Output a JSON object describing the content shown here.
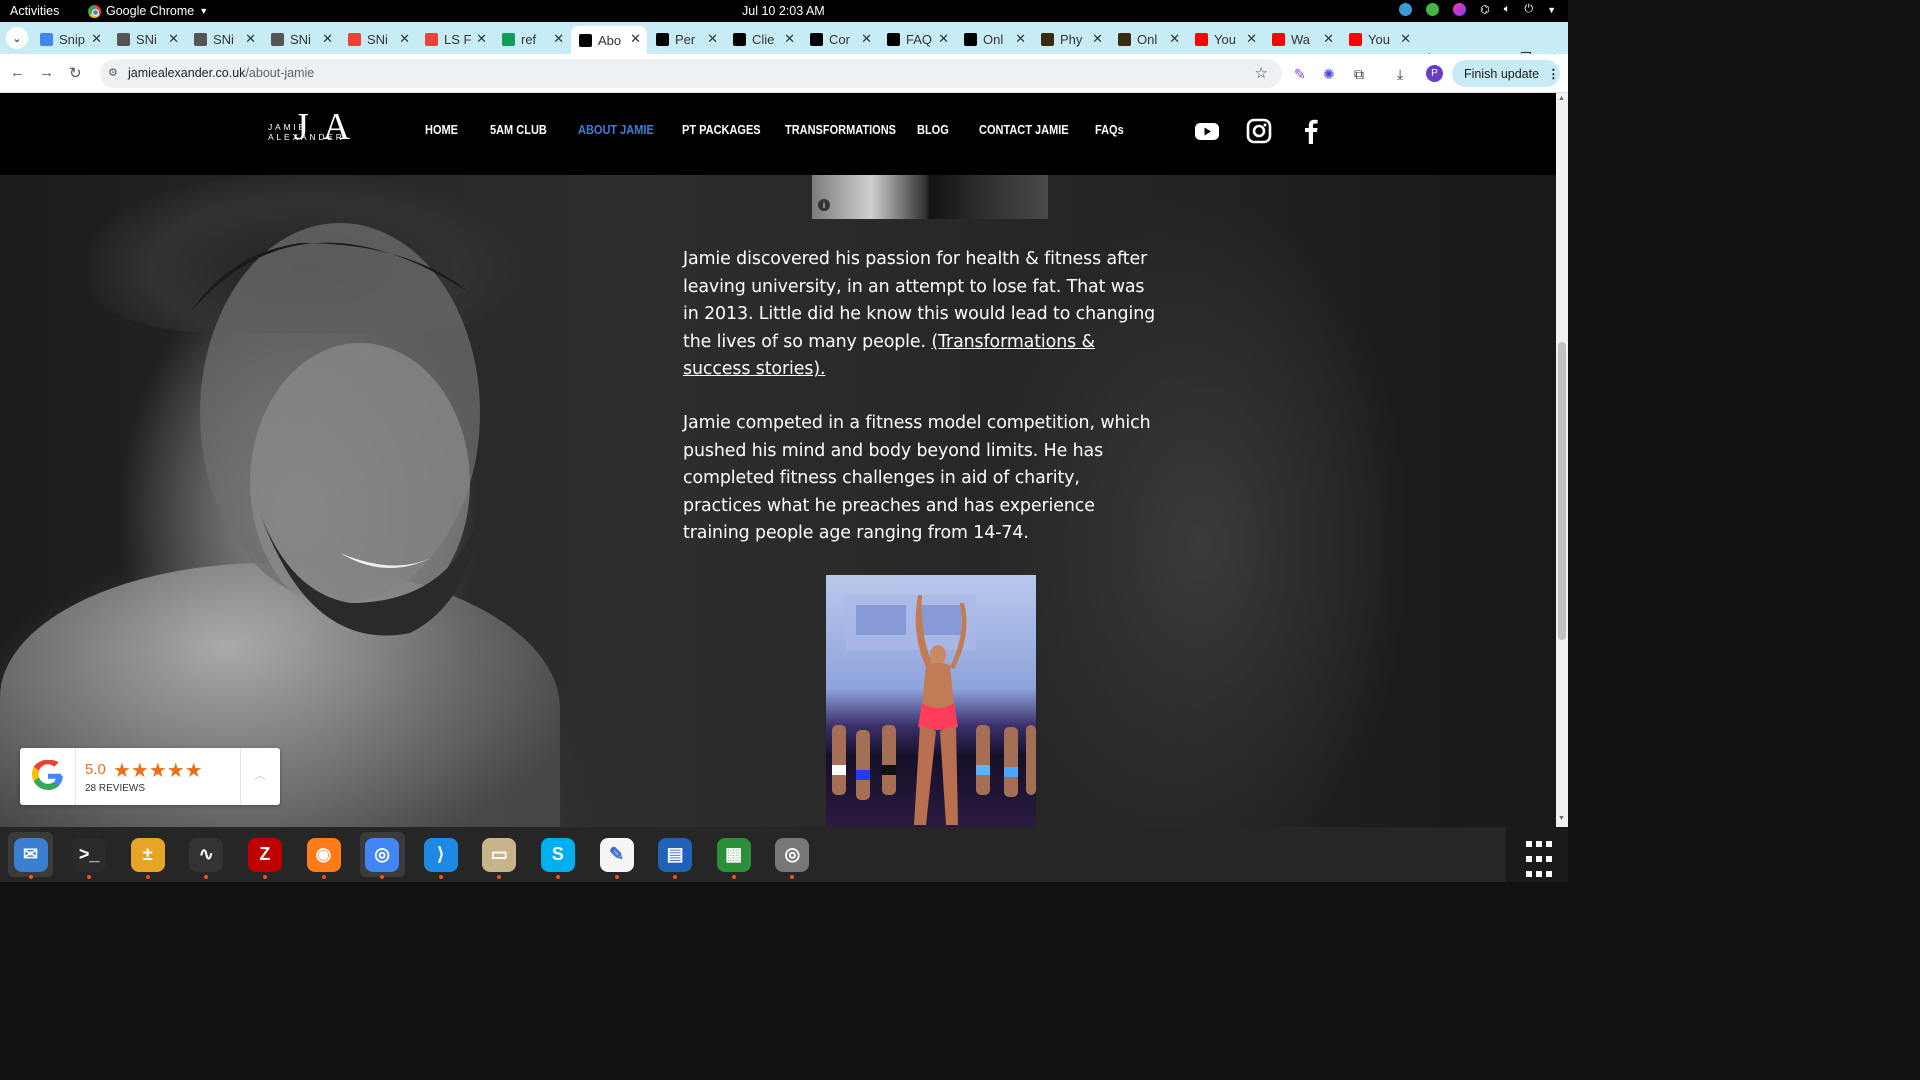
{
  "system": {
    "activities": "Activities",
    "app_name": "Google Chrome",
    "clock": "Jul 10  2:03 AM"
  },
  "tabs": [
    {
      "title": "Snip",
      "color": "#4285f4"
    },
    {
      "title": "SNi",
      "color": "#555555"
    },
    {
      "title": "SNi",
      "color": "#555555"
    },
    {
      "title": "SNi",
      "color": "#555555"
    },
    {
      "title": "SNi",
      "color": "#ea4335"
    },
    {
      "title": "LS F",
      "color": "#ea4335"
    },
    {
      "title": "ref",
      "color": "#0f9d58"
    },
    {
      "title": "Abo",
      "color": "#000000"
    },
    {
      "title": "Per",
      "color": "#000000"
    },
    {
      "title": "Clie",
      "color": "#000000"
    },
    {
      "title": "Cor",
      "color": "#000000"
    },
    {
      "title": "FAQ",
      "color": "#000000"
    },
    {
      "title": "Onl",
      "color": "#000000"
    },
    {
      "title": "Phy",
      "color": "#3a2a10"
    },
    {
      "title": "Onl",
      "color": "#3a2a10"
    },
    {
      "title": "You",
      "color": "#ff0000"
    },
    {
      "title": "Wa",
      "color": "#ff0000"
    },
    {
      "title": "You",
      "color": "#ff0000"
    }
  ],
  "address_bar": {
    "domain": "jamiealexander.co.uk",
    "path": "/about-jamie",
    "finish_update": "Finish update",
    "profile_initial": "P"
  },
  "site": {
    "logo_mark": "JA",
    "logo_name": "JAMIE ALEXANDER",
    "nav": [
      "HOME",
      "5AM CLUB",
      "ABOUT JAMIE",
      "PT PACKAGES",
      "TRANSFORMATIONS",
      "BLOG",
      "CONTACT JAMIE",
      "FAQs"
    ],
    "current_nav": "ABOUT JAMIE",
    "social": [
      "youtube-icon",
      "instagram-icon",
      "facebook-icon"
    ],
    "paragraph1": "Jamie discovered his passion for health & fitness after leaving university, in an attempt to lose fat. That was in 2013. Little did he know this would lead to changing the lives of so many people. ",
    "paragraph1_link": "(Transformations & success stories).",
    "paragraph2": "Jamie competed in a fitness model competition, which pushed his mind and body beyond limits. He has completed fitness challenges in aid of charity, practices what he preaches and has experience training people age ranging from 14-74."
  },
  "reviews": {
    "score": "5.0",
    "stars": "★★★★★",
    "count": "28 REVIEWS"
  },
  "dock": [
    "thunderbird-icon",
    "terminal-icon",
    "calculator-icon",
    "system-monitor-icon",
    "filezilla-icon",
    "firefox-icon",
    "chrome-icon",
    "vscode-icon",
    "files-icon",
    "skype-icon",
    "text-editor-icon",
    "libreoffice-writer-icon",
    "libreoffice-calc-icon",
    "disk-icon"
  ]
}
